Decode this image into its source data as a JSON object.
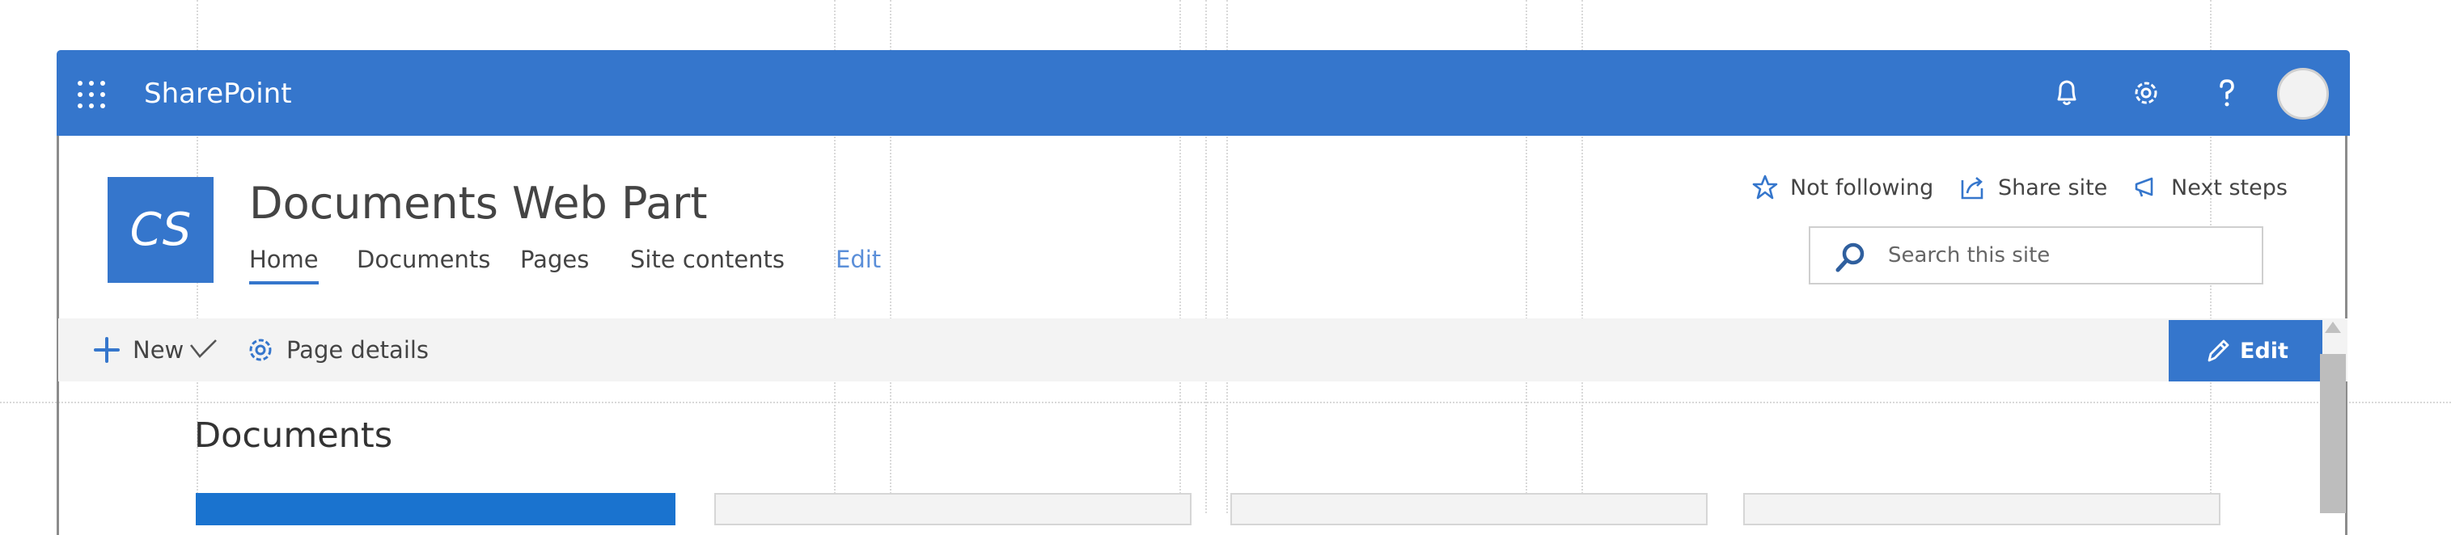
{
  "suite_bar": {
    "brand": "SharePoint",
    "icons": [
      "app-launcher-icon",
      "bell-icon",
      "gear-icon",
      "help-icon",
      "avatar"
    ],
    "color": "#3576cc"
  },
  "site": {
    "logo_text": "CS",
    "title": "Documents Web Part"
  },
  "nav": {
    "items": [
      {
        "label": "Home",
        "active": true
      },
      {
        "label": "Documents"
      },
      {
        "label": "Pages"
      },
      {
        "label": "Site contents"
      }
    ],
    "edit_label": "Edit"
  },
  "site_actions": {
    "follow_label": "Not following",
    "share_label": "Share site",
    "next_steps_label": "Next steps"
  },
  "search": {
    "placeholder": "Search this site"
  },
  "command_bar": {
    "new_label": "New",
    "page_details_label": "Page details",
    "edit_label": "Edit"
  },
  "main": {
    "section_title": "Documents",
    "tiles": [
      {
        "style": "blue"
      },
      {
        "style": "gray"
      },
      {
        "style": "gray"
      },
      {
        "style": "gray"
      }
    ]
  },
  "colors": {
    "accent": "#3576cc",
    "tile_blue": "#1a73cf",
    "command_bar_bg": "#f3f3f3"
  }
}
